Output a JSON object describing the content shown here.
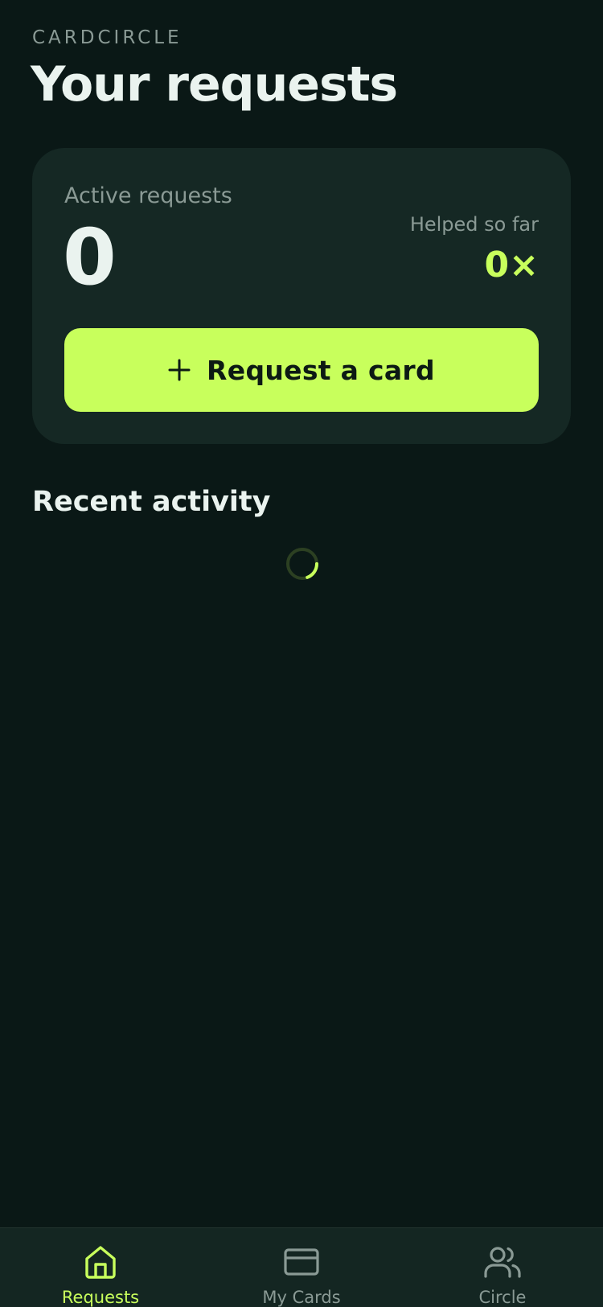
{
  "header": {
    "brand": "CARDCIRCLE",
    "title": "Your requests"
  },
  "summary": {
    "active_label": "Active requests",
    "active_count": "0",
    "helped_label": "Helped so far",
    "helped_count": "0×"
  },
  "actions": {
    "request_label": "Request a card",
    "request_icon": "plus-icon"
  },
  "activity": {
    "title": "Recent activity",
    "loading": true
  },
  "nav": {
    "active_index": 0,
    "items": [
      {
        "label": "Requests",
        "icon": "home-icon"
      },
      {
        "label": "My Cards",
        "icon": "card-icon"
      },
      {
        "label": "Circle",
        "icon": "users-icon"
      }
    ]
  },
  "colors": {
    "background": "#0a1816",
    "card": "#152824",
    "accent": "#c8ff5c",
    "muted": "#8a9a95",
    "text": "#eaf3ef"
  }
}
